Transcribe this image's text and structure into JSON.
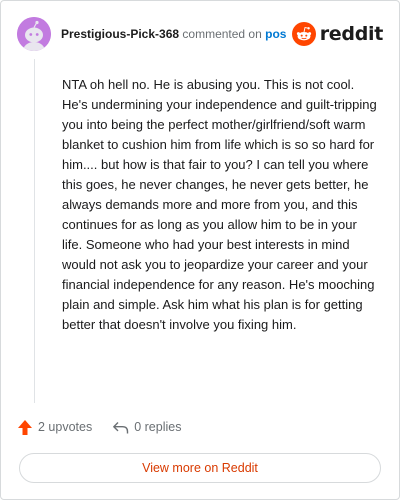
{
  "header": {
    "username": "Prestigious-Pick-368",
    "action_text": "commented on",
    "post_link": "post",
    "brand_wordmark": "reddit"
  },
  "comment": {
    "body": "NTA oh hell no. He is abusing you. This is not cool. He's undermining your independence and guilt-tripping you into being the perfect mother/girlfriend/soft warm blanket to cushion him from life which is so so hard for him.... but how is that fair to you? I can tell you where this goes, he never changes, he never gets better, he always demands more and more from you, and this continues for as long as you allow him to be in your life. Someone who had your best interests in mind would not ask you to jeopardize your career and your financial independence for any reason. He's mooching plain and simple. Ask him what his plan is for getting better that doesn't involve you fixing him."
  },
  "actions": {
    "upvotes": "2 upvotes",
    "replies": "0 replies"
  },
  "footer": {
    "view_more": "View more on Reddit"
  },
  "colors": {
    "brand_orange": "#ff4500",
    "link_blue": "#0079d3",
    "avatar_purple": "#c27be0",
    "view_more_text": "#d93a00"
  },
  "icons": {
    "avatar": "snoo-avatar-icon",
    "brand": "reddit-logo-icon",
    "upvote": "upvote-arrow-icon",
    "reply": "reply-arrow-icon"
  }
}
